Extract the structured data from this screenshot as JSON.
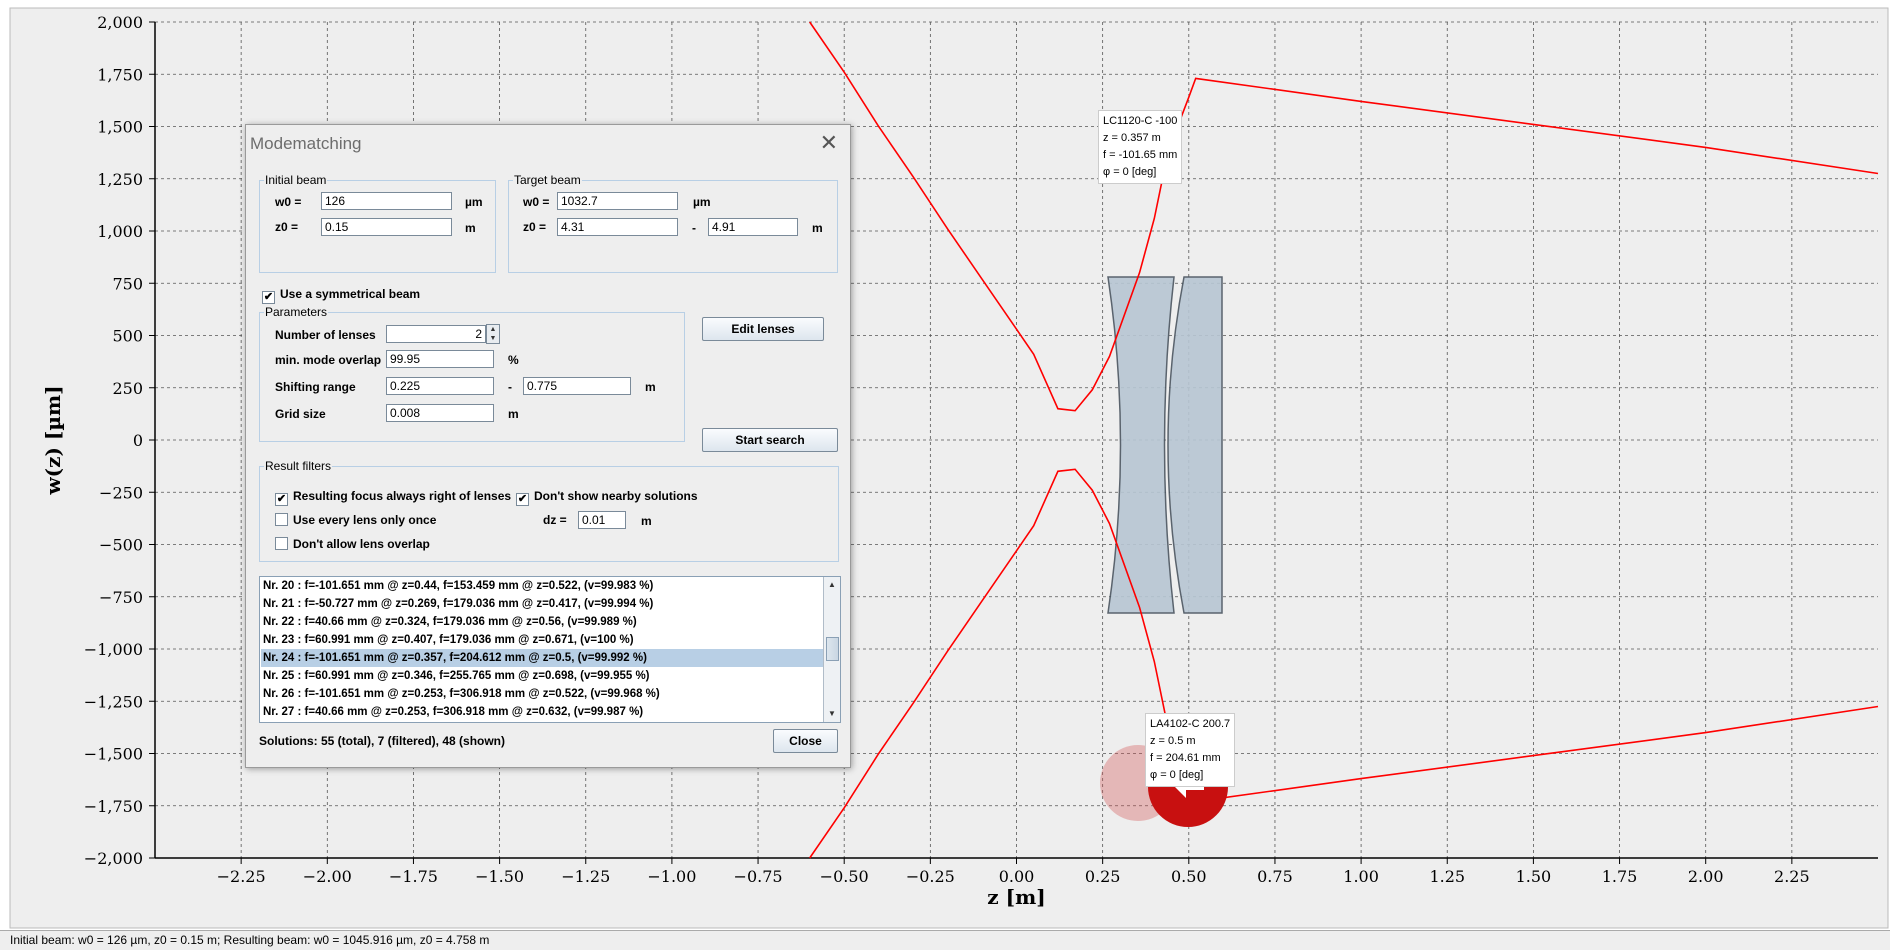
{
  "plot": {
    "xlabel": "z [m]",
    "ylabel": "w(z) [µm]",
    "x_ticks": [
      "−2.25",
      "−2.00",
      "−1.75",
      "−1.50",
      "−1.25",
      "−1.00",
      "−0.75",
      "−0.50",
      "−0.25",
      "0.00",
      "0.25",
      "0.50",
      "0.75",
      "1.00",
      "1.25",
      "1.50",
      "1.75",
      "2.00",
      "2.25"
    ],
    "y_ticks": [
      "2,000",
      "1,750",
      "1,500",
      "1,250",
      "1,000",
      "750",
      "500",
      "250",
      "0",
      "−250",
      "−500",
      "−750",
      "−1,000",
      "−1,250",
      "−1,500",
      "−1,750",
      "−2,000"
    ],
    "colors": {
      "beam": "#ff0000",
      "grid": "#555555",
      "plot_bg": "#eeeeee"
    }
  },
  "chart_data": {
    "type": "line",
    "xlabel": "z [m]",
    "ylabel": "w(z) [µm]",
    "xlim": [
      -2.5,
      2.5
    ],
    "ylim": [
      -2000,
      2000
    ],
    "grid": true,
    "series": [
      {
        "x": [
          -0.6,
          -0.5,
          -0.4,
          -0.3,
          -0.2,
          -0.1,
          0.0,
          0.05,
          0.12,
          0.17,
          0.22,
          0.27,
          0.357,
          0.4,
          0.44,
          0.5,
          0.52,
          1.0,
          1.5,
          2.0,
          2.5
        ],
        "y": [
          2000,
          1760,
          1500,
          1260,
          1010,
          770,
          530,
          410,
          150,
          140,
          240,
          400,
          800,
          1060,
          1380,
          1640,
          1730,
          1620,
          1510,
          1400,
          1275
        ]
      },
      {
        "x": [
          -0.6,
          -0.5,
          -0.4,
          -0.3,
          -0.2,
          -0.1,
          0.0,
          0.05,
          0.12,
          0.17,
          0.22,
          0.27,
          0.357,
          0.4,
          0.44,
          0.5,
          0.52,
          1.0,
          1.5,
          2.0,
          2.5
        ],
        "y": [
          -2000,
          -1760,
          -1500,
          -1260,
          -1010,
          -770,
          -530,
          -410,
          -150,
          -140,
          -240,
          -400,
          -800,
          -1060,
          -1380,
          -1640,
          -1730,
          -1620,
          -1510,
          -1400,
          -1275
        ]
      }
    ],
    "lenses": [
      {
        "name": "LC1120-C -100",
        "z": "z = 0.357 m",
        "f": "f = -101.65 mm",
        "phi": "φ = 0 [deg]",
        "z_value": 0.357
      },
      {
        "name": "LA4102-C 200.7",
        "z": "z = 0.5 m",
        "f": "f = 204.61 mm",
        "phi": "φ = 0 [deg]",
        "z_value": 0.5
      }
    ]
  },
  "dialog": {
    "title": "Modematching",
    "initial_beam": {
      "legend": "Initial beam",
      "w0_label": "w0 =",
      "w0_value": "126",
      "w0_unit": "µm",
      "z0_label": "z0 =",
      "z0_value": "0.15",
      "z0_unit": "m"
    },
    "target_beam": {
      "legend": "Target beam",
      "w0_label": "w0 =",
      "w0_value": "1032.7",
      "w0_unit": "µm",
      "z0_label": "z0 =",
      "z0_from": "4.31",
      "sep": "-",
      "z0_to": "4.91",
      "z0_unit": "m"
    },
    "symmetric_label": "Use a symmetrical beam",
    "symmetric_checked": "✔",
    "parameters": {
      "legend": "Parameters",
      "num_lenses_label": "Number of lenses",
      "num_lenses_value": "2",
      "overlap_label": "min. mode overlap",
      "overlap_value": "99.95",
      "overlap_unit": "%",
      "shift_label": "Shifting range",
      "shift_from": "0.225",
      "shift_sep": "-",
      "shift_to": "0.775",
      "shift_unit": "m",
      "grid_label": "Grid size",
      "grid_value": "0.008",
      "grid_unit": "m"
    },
    "edit_lenses_label": "Edit lenses",
    "start_search_label": "Start search",
    "filters": {
      "legend": "Result filters",
      "focus_right_label": "Resulting focus always right of lenses",
      "focus_right_checked": "✔",
      "nearby_label": "Don't show nearby solutions",
      "nearby_checked": "✔",
      "once_label": "Use every lens only once",
      "once_checked": "",
      "overlap_label": "Don't allow lens overlap",
      "overlap_checked": "",
      "dz_label": "dz =",
      "dz_value": "0.01",
      "dz_unit": "m"
    },
    "results": [
      "Nr. 20 : f=-101.651 mm @ z=0.44, f=153.459 mm @ z=0.522,  (v=99.983 %)",
      "Nr. 21 : f=-50.727 mm @ z=0.269, f=179.036 mm @ z=0.417,  (v=99.994 %)",
      "Nr. 22 : f=40.66 mm @ z=0.324, f=179.036 mm @ z=0.56,  (v=99.989 %)",
      "Nr. 23 : f=60.991 mm @ z=0.407, f=179.036 mm @ z=0.671,  (v=100 %)",
      "Nr. 24 : f=-101.651 mm @ z=0.357, f=204.612 mm @ z=0.5,  (v=99.992 %)",
      "Nr. 25 : f=60.991 mm @ z=0.346, f=255.765 mm @ z=0.698,  (v=99.955 %)",
      "Nr. 26 : f=-101.651 mm @ z=0.253, f=306.918 mm @ z=0.522,  (v=99.968 %)",
      "Nr. 27 : f=40.66 mm @ z=0.253, f=306.918 mm @ z=0.632,  (v=99.987 %)"
    ],
    "selected_index": 4,
    "solutions_text": "Solutions: 55 (total), 7 (filtered), 48 (shown)",
    "close_label": "Close"
  },
  "status_bar": "Initial beam: w0 = 126 µm, z0 = 0.15 m; Resulting beam: w0 = 1045.916 µm, z0 = 4.758 m"
}
